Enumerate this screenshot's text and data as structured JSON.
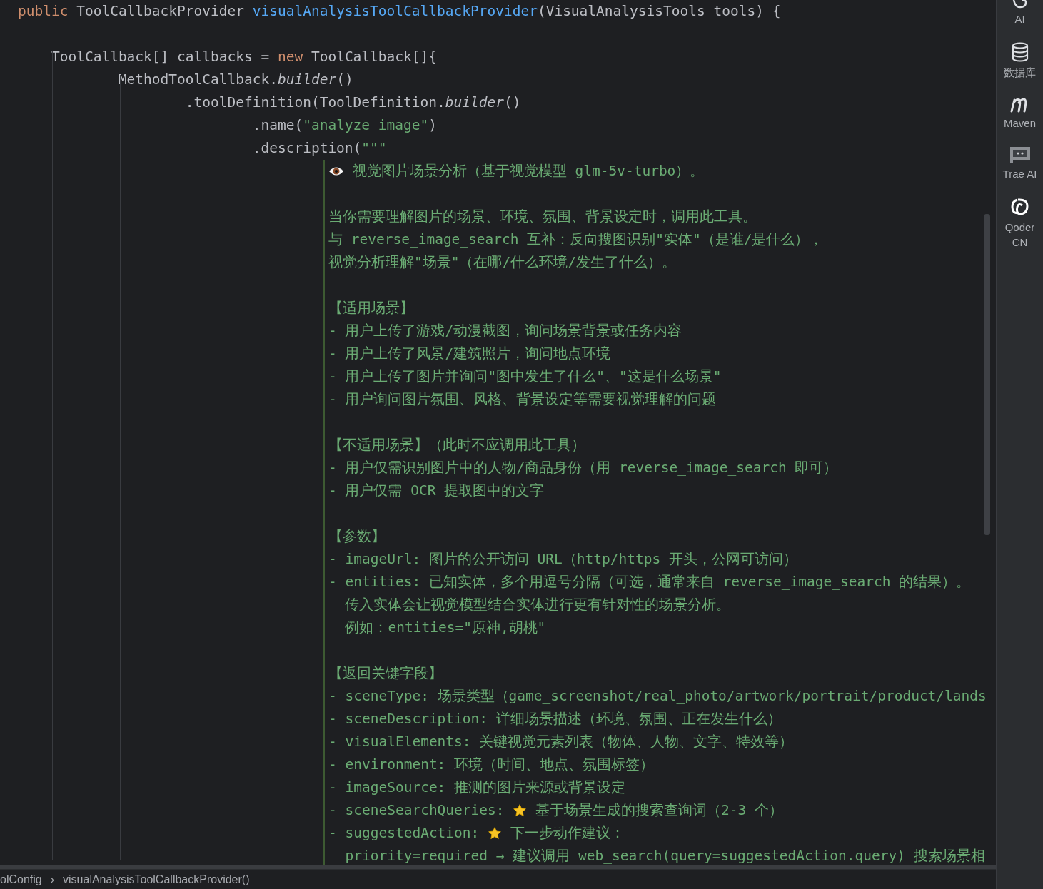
{
  "editor": {
    "lines": [
      {
        "kind": "code",
        "segments": [
          {
            "text": "public ",
            "kind": "kw"
          },
          {
            "text": "ToolCallbackProvider ",
            "kind": "plain"
          },
          {
            "text": "visualAnalysisToolCallbackProvider",
            "kind": "fn"
          },
          {
            "text": "(VisualAnalysisTools tools) {",
            "kind": "plain"
          }
        ]
      },
      {
        "kind": "blank"
      },
      {
        "kind": "code",
        "segments": [
          {
            "text": "    ToolCallback[] callbacks = ",
            "kind": "plain"
          },
          {
            "text": "new ",
            "kind": "kw"
          },
          {
            "text": "ToolCallback[]{",
            "kind": "plain"
          }
        ]
      },
      {
        "kind": "code",
        "segments": [
          {
            "text": "            MethodToolCallback.",
            "kind": "plain"
          },
          {
            "text": "builder",
            "kind": "method"
          },
          {
            "text": "()",
            "kind": "plain"
          }
        ]
      },
      {
        "kind": "code",
        "segments": [
          {
            "text": "                    .toolDefinition(ToolDefinition.",
            "kind": "plain"
          },
          {
            "text": "builder",
            "kind": "method"
          },
          {
            "text": "()",
            "kind": "plain"
          }
        ]
      },
      {
        "kind": "code",
        "segments": [
          {
            "text": "                            .name(",
            "kind": "plain"
          },
          {
            "text": "\"analyze_image\"",
            "kind": "string"
          },
          {
            "text": ")",
            "kind": "plain"
          }
        ]
      },
      {
        "kind": "code",
        "segments": [
          {
            "text": "                            .description(",
            "kind": "plain"
          },
          {
            "text": "\"\"\"",
            "kind": "string"
          }
        ]
      },
      {
        "kind": "text",
        "segments": [
          {
            "kind": "eye"
          },
          {
            "text": " 视觉图片场景分析（基于视觉模型 glm-5v-turbo）。",
            "kind": "string"
          }
        ]
      },
      {
        "kind": "text"
      },
      {
        "kind": "text",
        "segments": [
          {
            "text": "当你需要理解图片的场景、环境、氛围、背景设定时，调用此工具。",
            "kind": "string"
          }
        ]
      },
      {
        "kind": "text",
        "segments": [
          {
            "text": "与 reverse_image_search 互补：反向搜图识别\"实体\"（是谁/是什么），",
            "kind": "string"
          }
        ]
      },
      {
        "kind": "text",
        "segments": [
          {
            "text": "视觉分析理解\"场景\"（在哪/什么环境/发生了什么）。",
            "kind": "string"
          }
        ]
      },
      {
        "kind": "text"
      },
      {
        "kind": "text",
        "segments": [
          {
            "text": "【适用场景】",
            "kind": "string"
          }
        ]
      },
      {
        "kind": "text",
        "segments": [
          {
            "text": "- 用户上传了游戏/动漫截图，询问场景背景或任务内容",
            "kind": "string"
          }
        ]
      },
      {
        "kind": "text",
        "segments": [
          {
            "text": "- 用户上传了风景/建筑照片，询问地点环境",
            "kind": "string"
          }
        ]
      },
      {
        "kind": "text",
        "segments": [
          {
            "text": "- 用户上传了图片并询问\"图中发生了什么\"、\"这是什么场景\"",
            "kind": "string"
          }
        ]
      },
      {
        "kind": "text",
        "segments": [
          {
            "text": "- 用户询问图片氛围、风格、背景设定等需要视觉理解的问题",
            "kind": "string"
          }
        ]
      },
      {
        "kind": "text"
      },
      {
        "kind": "text",
        "segments": [
          {
            "text": "【不适用场景】（此时不应调用此工具）",
            "kind": "string"
          }
        ]
      },
      {
        "kind": "text",
        "segments": [
          {
            "text": "- 用户仅需识别图片中的人物/商品身份（用 reverse_image_search 即可）",
            "kind": "string"
          }
        ]
      },
      {
        "kind": "text",
        "segments": [
          {
            "text": "- 用户仅需 OCR 提取图中的文字",
            "kind": "string"
          }
        ]
      },
      {
        "kind": "text"
      },
      {
        "kind": "text",
        "segments": [
          {
            "text": "【参数】",
            "kind": "string"
          }
        ]
      },
      {
        "kind": "text",
        "segments": [
          {
            "text": "- imageUrl: 图片的公开访问 URL（http/https 开头，公网可访问）",
            "kind": "string"
          }
        ]
      },
      {
        "kind": "text",
        "segments": [
          {
            "text": "- entities: 已知实体，多个用逗号分隔（可选，通常来自 reverse_image_search 的结果）。",
            "kind": "string"
          }
        ]
      },
      {
        "kind": "text",
        "segments": [
          {
            "text": "  传入实体会让视觉模型结合实体进行更有针对性的场景分析。",
            "kind": "string"
          }
        ]
      },
      {
        "kind": "text",
        "segments": [
          {
            "text": "  例如：entities=\"原神,胡桃\"",
            "kind": "string"
          }
        ]
      },
      {
        "kind": "text"
      },
      {
        "kind": "text",
        "segments": [
          {
            "text": "【返回关键字段】",
            "kind": "string"
          }
        ]
      },
      {
        "kind": "text",
        "segments": [
          {
            "text": "- sceneType: 场景类型（game_screenshot/real_photo/artwork/portrait/product/lands",
            "kind": "string"
          }
        ]
      },
      {
        "kind": "text",
        "segments": [
          {
            "text": "- sceneDescription: 详细场景描述（环境、氛围、正在发生什么）",
            "kind": "string"
          }
        ]
      },
      {
        "kind": "text",
        "segments": [
          {
            "text": "- visualElements: 关键视觉元素列表（物体、人物、文字、特效等）",
            "kind": "string"
          }
        ]
      },
      {
        "kind": "text",
        "segments": [
          {
            "text": "- environment: 环境（时间、地点、氛围标签）",
            "kind": "string"
          }
        ]
      },
      {
        "kind": "text",
        "segments": [
          {
            "text": "- imageSource: 推测的图片来源或背景设定",
            "kind": "string"
          }
        ]
      },
      {
        "kind": "text",
        "segments": [
          {
            "text": "- sceneSearchQueries: ",
            "kind": "string"
          },
          {
            "kind": "star"
          },
          {
            "text": " 基于场景生成的搜索查询词（2-3 个）",
            "kind": "string"
          }
        ]
      },
      {
        "kind": "text",
        "segments": [
          {
            "text": "- suggestedAction: ",
            "kind": "string"
          },
          {
            "kind": "star"
          },
          {
            "text": " 下一步动作建议：",
            "kind": "string"
          }
        ]
      },
      {
        "kind": "text",
        "segments": [
          {
            "text": "  priority=required → 建议调用 web_search(query=suggestedAction.query) 搜索场景相",
            "kind": "string"
          }
        ]
      }
    ]
  },
  "breadcrumbs": {
    "items": [
      "olConfig",
      "visualAnalysisToolCallbackProvider()"
    ],
    "separator": "›"
  },
  "sidebar": {
    "items": [
      {
        "kind": "ai",
        "label": "AI"
      },
      {
        "kind": "database",
        "label": "数据库"
      },
      {
        "kind": "maven",
        "label": "Maven"
      },
      {
        "kind": "trae",
        "label": "Trae AI"
      },
      {
        "kind": "qoder",
        "label": "Qoder CN"
      }
    ]
  }
}
